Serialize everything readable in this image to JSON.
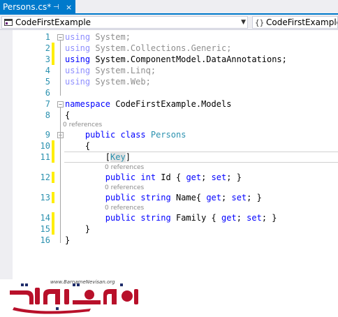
{
  "tab": {
    "title": "Persons.cs*",
    "pin_glyph": "⊣",
    "close_glyph": "×"
  },
  "nav": {
    "left_scope": "CodeFirstExample",
    "right_scope": "CodeFirstExample.Models"
  },
  "editor": {
    "lines": [
      {
        "n": "1",
        "parts": [
          {
            "t": "using",
            "c": "kw fade"
          },
          {
            "t": " System;",
            "c": "fade"
          }
        ]
      },
      {
        "n": "2",
        "parts": [
          {
            "t": "using",
            "c": "kw fade"
          },
          {
            "t": " System.Collections.Generic;",
            "c": "fade"
          }
        ]
      },
      {
        "n": "3",
        "parts": [
          {
            "t": "using",
            "c": "kw"
          },
          {
            "t": " System.ComponentModel.DataAnnotations;",
            "c": ""
          }
        ]
      },
      {
        "n": "4",
        "parts": [
          {
            "t": "using",
            "c": "kw fade"
          },
          {
            "t": " System.Linq;",
            "c": "fade"
          }
        ]
      },
      {
        "n": "5",
        "parts": [
          {
            "t": "using",
            "c": "kw fade"
          },
          {
            "t": " System.Web;",
            "c": "fade"
          }
        ]
      },
      {
        "n": "6",
        "parts": []
      },
      {
        "n": "7",
        "parts": [
          {
            "t": "namespace",
            "c": "kw"
          },
          {
            "t": " CodeFirstExample.Models",
            "c": ""
          }
        ]
      },
      {
        "n": "8",
        "parts": [
          {
            "t": "{",
            "c": ""
          }
        ]
      },
      {
        "n": "9",
        "parts": [
          {
            "t": "    public",
            "c": "kw"
          },
          {
            "t": " ",
            "c": ""
          },
          {
            "t": "class",
            "c": "kw"
          },
          {
            "t": " ",
            "c": ""
          },
          {
            "t": "Persons",
            "c": "ty"
          }
        ]
      },
      {
        "n": "10",
        "parts": [
          {
            "t": "    {",
            "c": ""
          }
        ]
      },
      {
        "n": "11",
        "parts": [
          {
            "t": "        [",
            "c": ""
          },
          {
            "t": "Key",
            "c": "ty keybox"
          },
          {
            "t": "]",
            "c": ""
          }
        ]
      },
      {
        "n": "12",
        "parts": [
          {
            "t": "        public",
            "c": "kw"
          },
          {
            "t": " ",
            "c": ""
          },
          {
            "t": "int",
            "c": "kw"
          },
          {
            "t": " Id { ",
            "c": ""
          },
          {
            "t": "get",
            "c": "kw"
          },
          {
            "t": "; ",
            "c": ""
          },
          {
            "t": "set",
            "c": "kw"
          },
          {
            "t": "; }",
            "c": ""
          }
        ]
      },
      {
        "n": "13",
        "parts": [
          {
            "t": "        public",
            "c": "kw"
          },
          {
            "t": " ",
            "c": ""
          },
          {
            "t": "string",
            "c": "kw"
          },
          {
            "t": " Name{ ",
            "c": ""
          },
          {
            "t": "get",
            "c": "kw"
          },
          {
            "t": "; ",
            "c": ""
          },
          {
            "t": "set",
            "c": "kw"
          },
          {
            "t": "; }",
            "c": ""
          }
        ]
      },
      {
        "n": "14",
        "parts": [
          {
            "t": "        public",
            "c": "kw"
          },
          {
            "t": " ",
            "c": ""
          },
          {
            "t": "string",
            "c": "kw"
          },
          {
            "t": " Family { ",
            "c": ""
          },
          {
            "t": "get",
            "c": "kw"
          },
          {
            "t": "; ",
            "c": ""
          },
          {
            "t": "set",
            "c": "kw"
          },
          {
            "t": "; }",
            "c": ""
          }
        ]
      },
      {
        "n": "15",
        "parts": [
          {
            "t": "    }",
            "c": ""
          }
        ]
      },
      {
        "n": "16",
        "parts": [
          {
            "t": "}",
            "c": ""
          }
        ]
      }
    ],
    "references_label": "0 references"
  },
  "logo": {
    "url": "www.BarnameNevisan.org",
    "brand_text": "برنامه نویسان"
  },
  "colors": {
    "accent": "#007acc",
    "keyword": "#0000ff",
    "type": "#2b91af",
    "changed": "#ffee00"
  }
}
